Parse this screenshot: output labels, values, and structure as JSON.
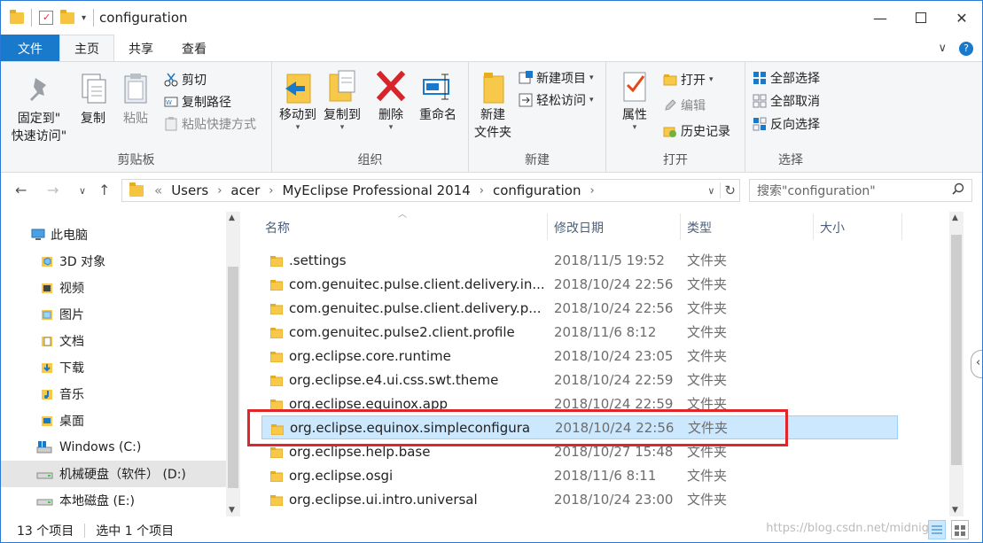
{
  "window": {
    "title": "configuration"
  },
  "ribbon_tabs": [
    "文件",
    "主页",
    "共享",
    "查看"
  ],
  "clipboard": {
    "label": "剪贴板",
    "pin": "固定到\"\n快速访问\"",
    "pin_line1": "固定到\"",
    "pin_line2": "快速访问\"",
    "copy": "复制",
    "paste": "粘贴",
    "cut": "剪切",
    "copy_path": "复制路径",
    "paste_shortcut": "粘贴快捷方式"
  },
  "organize": {
    "label": "组织",
    "move_to": "移动到",
    "copy_to": "复制到",
    "delete": "删除",
    "rename": "重命名"
  },
  "new": {
    "label": "新建",
    "new_folder_line1": "新建",
    "new_folder_line2": "文件夹",
    "new_item": "新建项目",
    "easy_access": "轻松访问"
  },
  "open": {
    "label": "打开",
    "properties": "属性",
    "open": "打开",
    "edit": "编辑",
    "history": "历史记录"
  },
  "select": {
    "label": "选择",
    "select_all": "全部选择",
    "select_none": "全部取消",
    "invert": "反向选择"
  },
  "address": {
    "prefix": "«",
    "crumbs": [
      "Users",
      "acer",
      "MyEclipse Professional 2014",
      "configuration"
    ],
    "search_placeholder": "搜索\"configuration\""
  },
  "nav_pane": [
    {
      "label": "此电脑",
      "icon": "pc-icon"
    },
    {
      "label": "3D 对象",
      "icon": "3d-objects-icon"
    },
    {
      "label": "视频",
      "icon": "video-icon"
    },
    {
      "label": "图片",
      "icon": "pictures-icon"
    },
    {
      "label": "文档",
      "icon": "documents-icon"
    },
    {
      "label": "下载",
      "icon": "downloads-icon"
    },
    {
      "label": "音乐",
      "icon": "music-icon"
    },
    {
      "label": "桌面",
      "icon": "desktop-icon"
    },
    {
      "label": "Windows (C:)",
      "icon": "drive-icon"
    },
    {
      "label": "机械硬盘（软件） (D:)",
      "icon": "drive-icon"
    },
    {
      "label": "本地磁盘 (E:)",
      "icon": "drive-icon"
    }
  ],
  "columns": {
    "name": "名称",
    "date": "修改日期",
    "type": "类型",
    "size": "大小"
  },
  "files": [
    {
      "name": ".settings",
      "date": "2018/11/5 19:52",
      "type": "文件夹"
    },
    {
      "name": "com.genuitec.pulse.client.delivery.in...",
      "date": "2018/10/24 22:56",
      "type": "文件夹"
    },
    {
      "name": "com.genuitec.pulse.client.delivery.p...",
      "date": "2018/10/24 22:56",
      "type": "文件夹"
    },
    {
      "name": "com.genuitec.pulse2.client.profile",
      "date": "2018/11/6 8:12",
      "type": "文件夹"
    },
    {
      "name": "org.eclipse.core.runtime",
      "date": "2018/10/24 23:05",
      "type": "文件夹"
    },
    {
      "name": "org.eclipse.e4.ui.css.swt.theme",
      "date": "2018/10/24 22:59",
      "type": "文件夹"
    },
    {
      "name": "org.eclipse.equinox.app",
      "date": "2018/10/24 22:59",
      "type": "文件夹"
    },
    {
      "name": "org.eclipse.equinox.simpleconfigura",
      "date": "2018/10/24 22:56",
      "type": "文件夹"
    },
    {
      "name": "org.eclipse.help.base",
      "date": "2018/10/27 15:48",
      "type": "文件夹"
    },
    {
      "name": "org.eclipse.osgi",
      "date": "2018/11/6 8:11",
      "type": "文件夹"
    },
    {
      "name": "org.eclipse.ui.intro.universal",
      "date": "2018/10/24 23:00",
      "type": "文件夹"
    }
  ],
  "selected_file": "org.eclipse.equinox.simpleconfigura",
  "status": {
    "count": "13 个项目",
    "selected": "选中 1 个项目"
  },
  "watermark": "https://blog.csdn.net/midnig",
  "colors": {
    "accent": "#1979ca",
    "selection": "#cce8ff",
    "highlight_box": "#e0262a"
  }
}
